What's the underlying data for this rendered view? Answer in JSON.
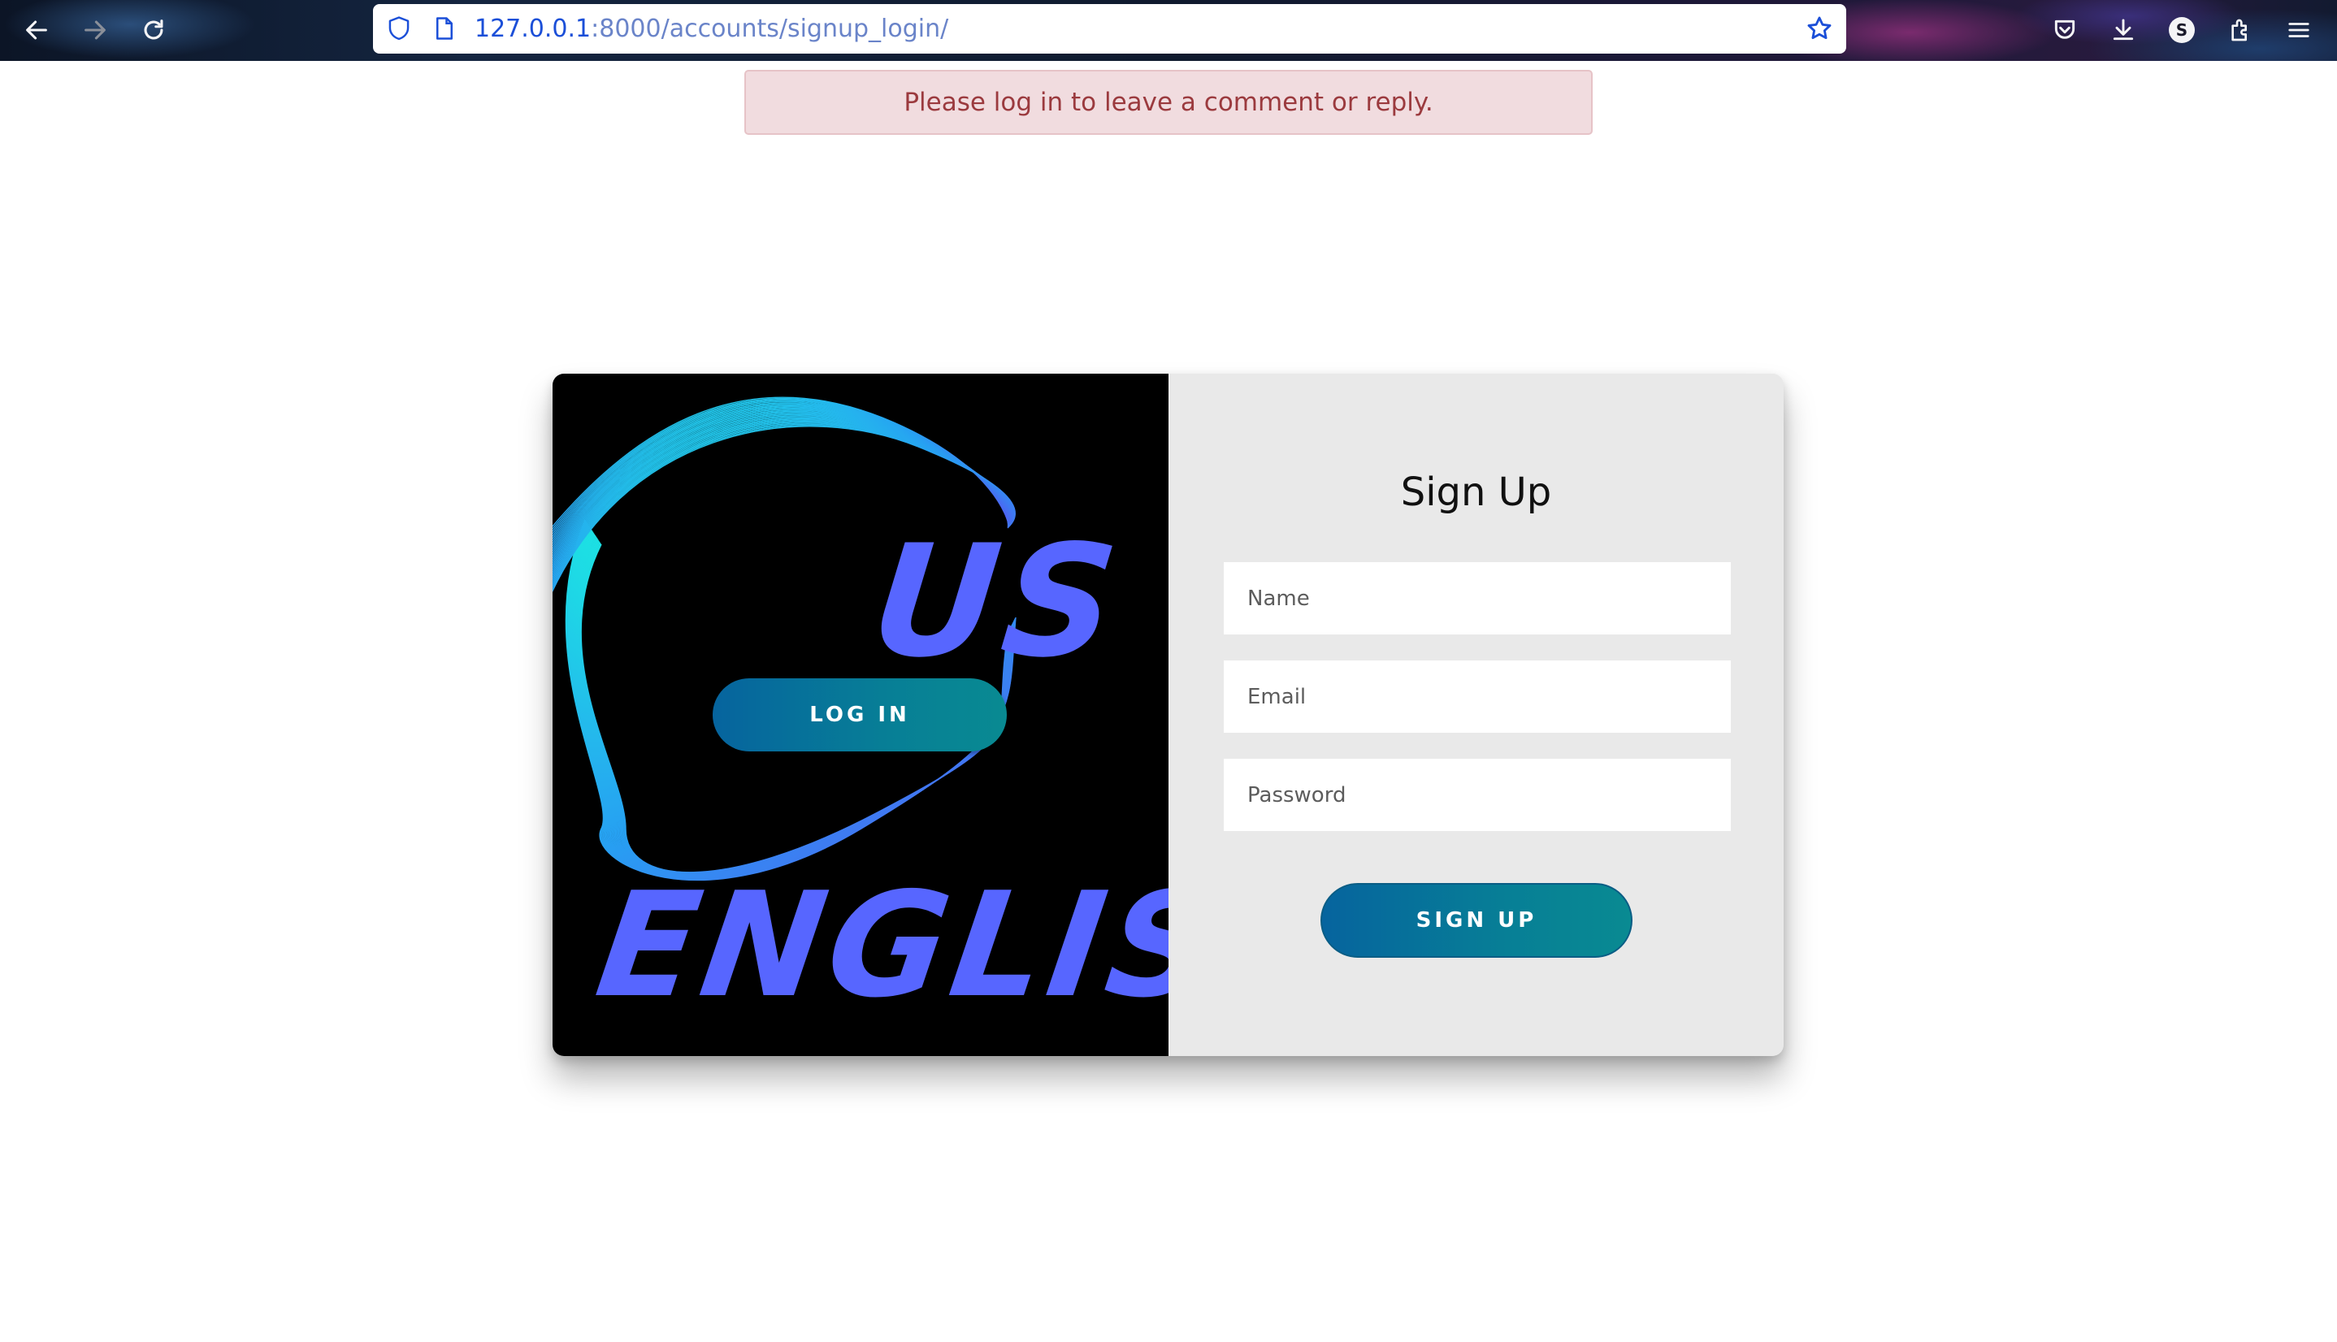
{
  "browser": {
    "url_host": "127.0.0.1",
    "url_path": ":8000/accounts/signup_login/",
    "profile_initial": "S",
    "icons": [
      "back-arrow-icon",
      "forward-arrow-icon",
      "reload-icon",
      "shield-icon",
      "page-icon",
      "bookmark-star-icon",
      "pocket-icon",
      "download-icon",
      "account-icon",
      "extensions-icon",
      "menu-icon"
    ]
  },
  "alert": {
    "message": "Please log in to leave a comment or reply."
  },
  "left_panel": {
    "login_label": "LOG IN",
    "artwork_text_top": "US",
    "artwork_text_bottom": "ENGLIS"
  },
  "signup_form": {
    "title": "Sign Up",
    "name_placeholder": "Name",
    "email_placeholder": "Email",
    "password_placeholder": "Password",
    "submit_label": "SIGN UP"
  },
  "colors": {
    "button_gradient_start": "#06649e",
    "button_gradient_end": "#098a92",
    "alert_bg": "#f1dcdf",
    "alert_text": "#9b3a3e",
    "artwork_text": "#5766ff",
    "artwork_wave": "#22d8f0"
  }
}
